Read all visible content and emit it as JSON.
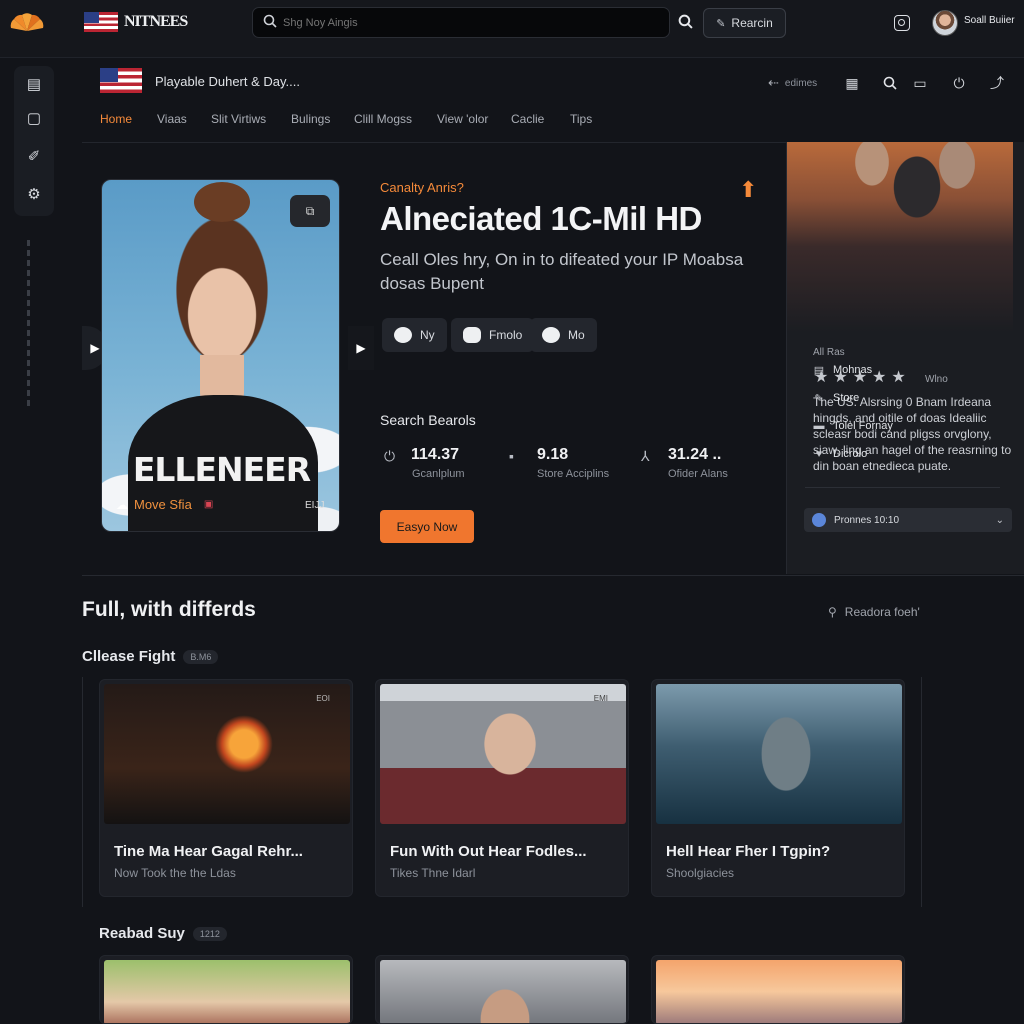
{
  "topbar": {
    "brand": "NITNEES",
    "search_placeholder": "Shg Noy Aingis",
    "search_button": "Rearcin",
    "user_name": "Soall Buiier"
  },
  "header": {
    "title": "Playable Duhert & Day....",
    "back_label": "edimes",
    "tabs": [
      "Home",
      "Viaas",
      "Slit Virtiws",
      "Bulings",
      "Clill Mogss",
      "View 'olor",
      "Caclie",
      "Tips"
    ],
    "active_tab": "Home"
  },
  "hero": {
    "poster_title": "ELLENEER",
    "poster_label": "Move Sfia",
    "poster_rating": "EIJJ",
    "kicker": "Canalty Anris?",
    "title": "Alneciated 1C-Mil HD",
    "description": "Ceall Oles hry, On in to difeated your IP Moabsa dosas Bupent",
    "pills": [
      "Ny",
      "Fmolo",
      "Mo"
    ],
    "stats_heading": "Search Bearols",
    "stats": [
      {
        "value": "114.37",
        "label": "Gcanlplum"
      },
      {
        "value": "9.18",
        "label": "Store Acciplins"
      },
      {
        "value": "31.24 ..",
        "label": "Ofider Alans"
      }
    ],
    "cta": "Easyo Now"
  },
  "side_panel": {
    "small_label": "All Ras",
    "rating_stars": 5,
    "rating_label": "Wlno",
    "description": "The US: Alsrsing 0 Bnam Irdeana hingds, and oitile of doas Idealiic scleasr bodi cand pligss orvglony, siaw, ling an hagel of the reasrning to din boan etnedieca puate.",
    "items": [
      {
        "icon": "document-icon",
        "label": "Mohnas"
      },
      {
        "icon": "pen-icon",
        "label": "Store"
      },
      {
        "icon": "list-icon",
        "label": "Tolel Fornay"
      },
      {
        "icon": "heart-icon",
        "label": "Dicrolo"
      }
    ],
    "select_value": "Pronnes 10:10"
  },
  "lower": {
    "section_title": "Full, with differds",
    "read_more": "Readora foeh'",
    "row1_title": "Cllease Fight",
    "row1_badge": "B.M6",
    "row1_cards": [
      {
        "title": "Tine Ma Hear Gagal Rehr...",
        "subtitle": "Now Took the the Ldas",
        "tag": "EOI"
      },
      {
        "title": "Fun With Out Hear Fodles...",
        "subtitle": "Tikes Thne Idarl",
        "tag": "EMI"
      },
      {
        "title": "Hell Hear Fher I Tgpin?",
        "subtitle": "Shoolgiacies",
        "tag": ""
      }
    ],
    "row2_title": "Reabad Suy",
    "row2_badge": "1212"
  }
}
